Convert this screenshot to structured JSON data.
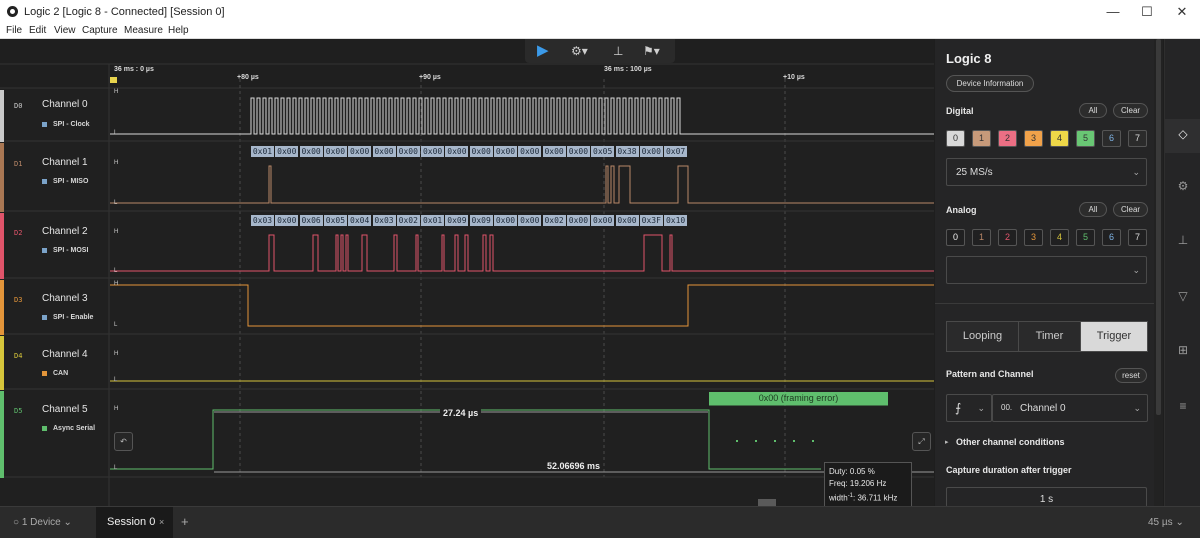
{
  "window": {
    "title": "Logic 2 [Logic 8 - Connected] [Session 0]"
  },
  "menu": [
    "File",
    "Edit",
    "View",
    "Capture",
    "Measure",
    "Help"
  ],
  "toolbar": {
    "play": "▶"
  },
  "ruler": {
    "start": "36 ms : 0 µs",
    "mid": "36 ms : 100 µs",
    "ticks": [
      "+80 µs",
      "+90 µs",
      "+10 µs"
    ]
  },
  "channels": [
    {
      "id": "D0",
      "name": "Channel 0",
      "analyzer": "SPI - Clock",
      "color": "#c9c9c9"
    },
    {
      "id": "D1",
      "name": "Channel 1",
      "analyzer": "SPI - MISO",
      "color": "#a97753"
    },
    {
      "id": "D2",
      "name": "Channel 2",
      "analyzer": "SPI - MOSI",
      "color": "#e0546a"
    },
    {
      "id": "D3",
      "name": "Channel 3",
      "analyzer": "SPI - Enable",
      "color": "#e3953a"
    },
    {
      "id": "D4",
      "name": "Channel 4",
      "analyzer": "CAN",
      "color": "#d6c53b"
    },
    {
      "id": "D5",
      "name": "Channel 5",
      "analyzer": "Async Serial",
      "color": "#5fbe6d"
    }
  ],
  "levels": {
    "high": "H",
    "low": "L"
  },
  "miso_bytes": [
    "0x01",
    "0x00",
    "0x00",
    "0x00",
    "0x00",
    "0x00",
    "0x00",
    "0x00",
    "0x00",
    "0x00",
    "0x00",
    "0x00",
    "0x00",
    "0x00",
    "0x05",
    "0x38",
    "0x00",
    "0x07"
  ],
  "mosi_bytes": [
    "0x03",
    "0x00",
    "0x06",
    "0x05",
    "0x04",
    "0x03",
    "0x02",
    "0x01",
    "0x09",
    "0x09",
    "0x00",
    "0x00",
    "0x02",
    "0x00",
    "0x00",
    "0x00",
    "0x3F",
    "0x10"
  ],
  "serial": {
    "frame_label": "0x00 (framing error)",
    "pulse_width": "27.24 µs",
    "period": "52.06696 ms"
  },
  "tooltip": {
    "duty": "Duty: 0.05 %",
    "freq": "Freq: 19.206 Hz",
    "width_label": "width",
    "width_value": ": 36.711 kHz",
    "width_sup": "-1"
  },
  "panel": {
    "device": "Logic 8",
    "device_info": "Device Information",
    "digital_label": "Digital",
    "all": "All",
    "clear": "Clear",
    "channel_numbers": [
      "0",
      "1",
      "2",
      "3",
      "4",
      "5",
      "6",
      "7"
    ],
    "digital_rate": "25 MS/s",
    "analog_label": "Analog",
    "analog_rate": "",
    "modes": [
      "Looping",
      "Timer",
      "Trigger"
    ],
    "pattern_label": "Pattern and Channel",
    "reset": "reset",
    "trigger_channel_prefix": "00.",
    "trigger_channel": "Channel 0",
    "other_conditions": "Other channel conditions",
    "duration_label": "Capture duration after trigger",
    "duration_value": "1 s"
  },
  "bottom": {
    "devices": "1 Device",
    "session": "Session 0",
    "add": "+",
    "zoom": "45 µs"
  },
  "colors": {
    "chip_bg": [
      "#d9d9d9",
      "#c79a7a",
      "#ec6f84",
      "#f1a24a",
      "#efd848",
      "#69c774",
      "#2b2b2b",
      "#2b2b2b"
    ],
    "chip_fg": [
      "#333",
      "#333",
      "#333",
      "#333",
      "#333",
      "#333",
      "#7fb4e6",
      "#ddd"
    ]
  }
}
